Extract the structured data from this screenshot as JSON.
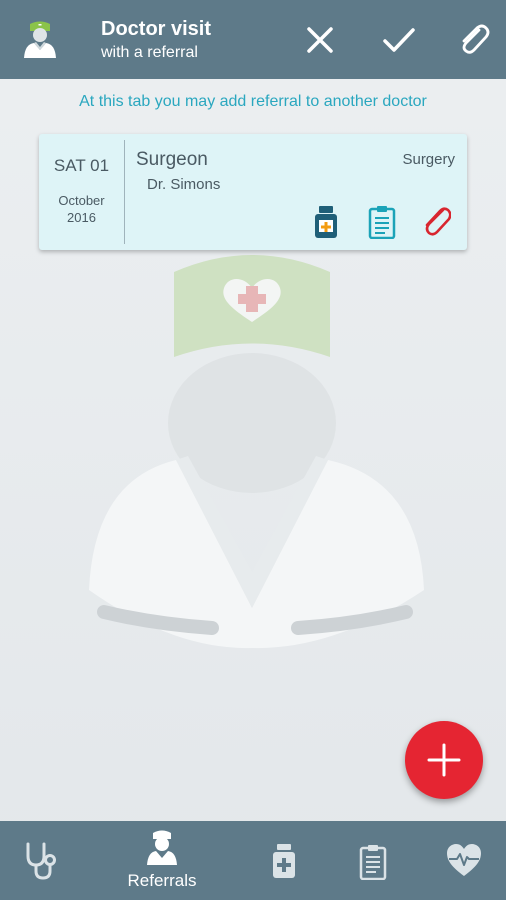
{
  "appbar": {
    "title": "Doctor visit",
    "subtitle": "with a referral",
    "avatar_icon": "doctor-avatar-icon",
    "actions": [
      "close-icon",
      "check-icon",
      "paperclip-icon"
    ]
  },
  "hint": "At this tab you may add referral to another doctor",
  "referral": {
    "day": "SAT 01",
    "month": "October",
    "year": "2016",
    "specialty": "Surgeon",
    "doctor": "Dr. Simons",
    "department": "Surgery",
    "icons": [
      "medicine-bottle-icon",
      "clipboard-icon",
      "paperclip-icon"
    ]
  },
  "fab_icon": "plus-icon",
  "bottom_nav": {
    "items": [
      {
        "icon": "stethoscope-icon",
        "label": ""
      },
      {
        "icon": "doctor-icon",
        "label": "Referrals"
      },
      {
        "icon": "medicine-bottle-icon",
        "label": ""
      },
      {
        "icon": "clipboard-icon",
        "label": ""
      },
      {
        "icon": "heart-pulse-icon",
        "label": ""
      }
    ],
    "active_index": 1
  },
  "colors": {
    "appbar": "#5e7a89",
    "accent_text": "#2aa7bf",
    "card_bg": "#def4f7",
    "fab": "#e52532",
    "clip_red": "#d8262f",
    "bottle_dark": "#1f5f78",
    "clipboard_teal": "#1ba3b8"
  }
}
